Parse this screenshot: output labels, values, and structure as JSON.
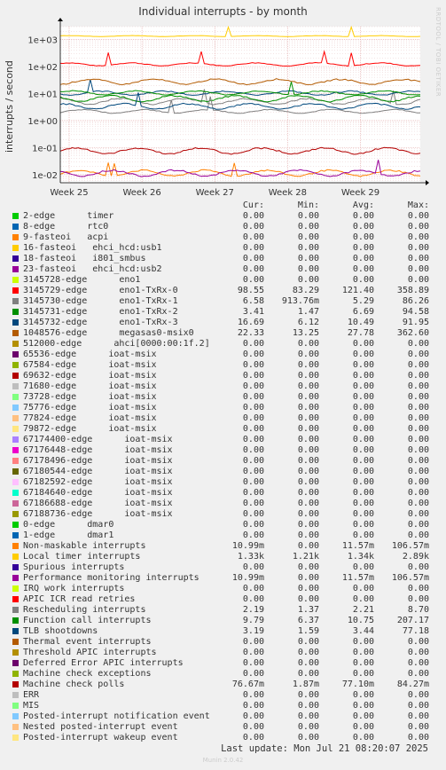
{
  "title": "Individual interrupts - by month",
  "side_text": "RRDTOOL / TOBI OETIKER",
  "columns": [
    "Cur:",
    "Min:",
    "Avg:",
    "Max:"
  ],
  "footer": "Last update: Mon Jul 21 08:20:07 2025",
  "munin_version": "Munin 2.0.42",
  "chart_data": {
    "type": "line",
    "title": "Individual interrupts - by month",
    "ylabel": "interrupts / second",
    "yscale": "log",
    "ylim": [
      0.005,
      3000
    ],
    "yticks": [
      "1e-02",
      "1e-01",
      "1e+00",
      "1e+01",
      "1e+02",
      "1e+03"
    ],
    "x_ticks": [
      "Week 25",
      "Week 26",
      "Week 27",
      "Week 28",
      "Week 29"
    ],
    "grid": true,
    "series": [
      {
        "name": "2-edge      timer",
        "color": "#00cc00",
        "cur": "0.00",
        "min": "0.00",
        "avg": "0.00",
        "max": "0.00"
      },
      {
        "name": "8-edge      rtc0",
        "color": "#0066b3",
        "cur": "0.00",
        "min": "0.00",
        "avg": "0.00",
        "max": "0.00"
      },
      {
        "name": "9-fasteoi   acpi",
        "color": "#ff8000",
        "cur": "0.00",
        "min": "0.00",
        "avg": "0.00",
        "max": "0.00"
      },
      {
        "name": "16-fasteoi   ehci_hcd:usb1",
        "color": "#ffcc00",
        "cur": "0.00",
        "min": "0.00",
        "avg": "0.00",
        "max": "0.00"
      },
      {
        "name": "18-fasteoi   i801_smbus",
        "color": "#330099",
        "cur": "0.00",
        "min": "0.00",
        "avg": "0.00",
        "max": "0.00"
      },
      {
        "name": "23-fasteoi   ehci_hcd:usb2",
        "color": "#990099",
        "cur": "0.00",
        "min": "0.00",
        "avg": "0.00",
        "max": "0.00"
      },
      {
        "name": "3145728-edge      eno1",
        "color": "#ccff00",
        "cur": "0.00",
        "min": "0.00",
        "avg": "0.00",
        "max": "0.00"
      },
      {
        "name": "3145729-edge      eno1-TxRx-0",
        "color": "#ff0000",
        "cur": "98.55",
        "min": "83.29",
        "avg": "121.40",
        "max": "358.89"
      },
      {
        "name": "3145730-edge      eno1-TxRx-1",
        "color": "#808080",
        "cur": "6.58",
        "min": "913.76m",
        "avg": "5.29",
        "max": "86.26"
      },
      {
        "name": "3145731-edge      eno1-TxRx-2",
        "color": "#008f00",
        "cur": "3.41",
        "min": "1.47",
        "avg": "6.69",
        "max": "94.58"
      },
      {
        "name": "3145732-edge      eno1-TxRx-3",
        "color": "#00487d",
        "cur": "16.69",
        "min": "6.12",
        "avg": "10.49",
        "max": "91.95"
      },
      {
        "name": "1048576-edge      megasas0-msix0",
        "color": "#b35a00",
        "cur": "22.33",
        "min": "13.25",
        "avg": "27.78",
        "max": "362.60"
      },
      {
        "name": "512000-edge      ahci[0000:00:1f.2]",
        "color": "#b38f00",
        "cur": "0.00",
        "min": "0.00",
        "avg": "0.00",
        "max": "0.00"
      },
      {
        "name": "65536-edge      ioat-msix",
        "color": "#6b006b",
        "cur": "0.00",
        "min": "0.00",
        "avg": "0.00",
        "max": "0.00"
      },
      {
        "name": "67584-edge      ioat-msix",
        "color": "#8fb300",
        "cur": "0.00",
        "min": "0.00",
        "avg": "0.00",
        "max": "0.00"
      },
      {
        "name": "69632-edge      ioat-msix",
        "color": "#b30000",
        "cur": "0.00",
        "min": "0.00",
        "avg": "0.00",
        "max": "0.00"
      },
      {
        "name": "71680-edge      ioat-msix",
        "color": "#bebebe",
        "cur": "0.00",
        "min": "0.00",
        "avg": "0.00",
        "max": "0.00"
      },
      {
        "name": "73728-edge      ioat-msix",
        "color": "#80ff80",
        "cur": "0.00",
        "min": "0.00",
        "avg": "0.00",
        "max": "0.00"
      },
      {
        "name": "75776-edge      ioat-msix",
        "color": "#80c9ff",
        "cur": "0.00",
        "min": "0.00",
        "avg": "0.00",
        "max": "0.00"
      },
      {
        "name": "77824-edge      ioat-msix",
        "color": "#ffc080",
        "cur": "0.00",
        "min": "0.00",
        "avg": "0.00",
        "max": "0.00"
      },
      {
        "name": "79872-edge      ioat-msix",
        "color": "#ffe680",
        "cur": "0.00",
        "min": "0.00",
        "avg": "0.00",
        "max": "0.00"
      },
      {
        "name": "67174400-edge      ioat-msix",
        "color": "#aa80ff",
        "cur": "0.00",
        "min": "0.00",
        "avg": "0.00",
        "max": "0.00"
      },
      {
        "name": "67176448-edge      ioat-msix",
        "color": "#ee00cc",
        "cur": "0.00",
        "min": "0.00",
        "avg": "0.00",
        "max": "0.00"
      },
      {
        "name": "67178496-edge      ioat-msix",
        "color": "#ff8080",
        "cur": "0.00",
        "min": "0.00",
        "avg": "0.00",
        "max": "0.00"
      },
      {
        "name": "67180544-edge      ioat-msix",
        "color": "#666600",
        "cur": "0.00",
        "min": "0.00",
        "avg": "0.00",
        "max": "0.00"
      },
      {
        "name": "67182592-edge      ioat-msix",
        "color": "#ffbfff",
        "cur": "0.00",
        "min": "0.00",
        "avg": "0.00",
        "max": "0.00"
      },
      {
        "name": "67184640-edge      ioat-msix",
        "color": "#00ffcc",
        "cur": "0.00",
        "min": "0.00",
        "avg": "0.00",
        "max": "0.00"
      },
      {
        "name": "67186688-edge      ioat-msix",
        "color": "#cc6699",
        "cur": "0.00",
        "min": "0.00",
        "avg": "0.00",
        "max": "0.00"
      },
      {
        "name": "67188736-edge      ioat-msix",
        "color": "#999900",
        "cur": "0.00",
        "min": "0.00",
        "avg": "0.00",
        "max": "0.00"
      },
      {
        "name": "0-edge      dmar0",
        "color": "#00cc00",
        "cur": "0.00",
        "min": "0.00",
        "avg": "0.00",
        "max": "0.00"
      },
      {
        "name": "1-edge      dmar1",
        "color": "#0066b3",
        "cur": "0.00",
        "min": "0.00",
        "avg": "0.00",
        "max": "0.00"
      },
      {
        "name": "Non-maskable interrupts",
        "color": "#ff8000",
        "cur": "10.99m",
        "min": "0.00",
        "avg": "11.57m",
        "max": "106.57m"
      },
      {
        "name": "Local timer interrupts",
        "color": "#ffcc00",
        "cur": "1.33k",
        "min": "1.21k",
        "avg": "1.34k",
        "max": "2.89k"
      },
      {
        "name": "Spurious interrupts",
        "color": "#330099",
        "cur": "0.00",
        "min": "0.00",
        "avg": "0.00",
        "max": "0.00"
      },
      {
        "name": "Performance monitoring interrupts",
        "color": "#990099",
        "cur": "10.99m",
        "min": "0.00",
        "avg": "11.57m",
        "max": "106.57m"
      },
      {
        "name": "IRQ work interrupts",
        "color": "#ccff00",
        "cur": "0.00",
        "min": "0.00",
        "avg": "0.00",
        "max": "0.00"
      },
      {
        "name": "APIC ICR read retries",
        "color": "#ff0000",
        "cur": "0.00",
        "min": "0.00",
        "avg": "0.00",
        "max": "0.00"
      },
      {
        "name": "Rescheduling interrupts",
        "color": "#808080",
        "cur": "2.19",
        "min": "1.37",
        "avg": "2.21",
        "max": "8.70"
      },
      {
        "name": "Function call interrupts",
        "color": "#008f00",
        "cur": "9.79",
        "min": "6.37",
        "avg": "10.75",
        "max": "207.17"
      },
      {
        "name": "TLB shootdowns",
        "color": "#00487d",
        "cur": "3.19",
        "min": "1.59",
        "avg": "3.44",
        "max": "77.18"
      },
      {
        "name": "Thermal event interrupts",
        "color": "#b35a00",
        "cur": "0.00",
        "min": "0.00",
        "avg": "0.00",
        "max": "0.00"
      },
      {
        "name": "Threshold APIC interrupts",
        "color": "#b38f00",
        "cur": "0.00",
        "min": "0.00",
        "avg": "0.00",
        "max": "0.00"
      },
      {
        "name": "Deferred Error APIC interrupts",
        "color": "#6b006b",
        "cur": "0.00",
        "min": "0.00",
        "avg": "0.00",
        "max": "0.00"
      },
      {
        "name": "Machine check exceptions",
        "color": "#8fb300",
        "cur": "0.00",
        "min": "0.00",
        "avg": "0.00",
        "max": "0.00"
      },
      {
        "name": "Machine check polls",
        "color": "#b30000",
        "cur": "76.67m",
        "min": "1.87m",
        "avg": "77.10m",
        "max": "84.27m"
      },
      {
        "name": "ERR",
        "color": "#bebebe",
        "cur": "0.00",
        "min": "0.00",
        "avg": "0.00",
        "max": "0.00"
      },
      {
        "name": "MIS",
        "color": "#80ff80",
        "cur": "0.00",
        "min": "0.00",
        "avg": "0.00",
        "max": "0.00"
      },
      {
        "name": "Posted-interrupt notification event",
        "color": "#80c9ff",
        "cur": "0.00",
        "min": "0.00",
        "avg": "0.00",
        "max": "0.00"
      },
      {
        "name": "Nested posted-interrupt event",
        "color": "#ffc080",
        "cur": "0.00",
        "min": "0.00",
        "avg": "0.00",
        "max": "0.00"
      },
      {
        "name": "Posted-interrupt wakeup event",
        "color": "#ffe680",
        "cur": "0.00",
        "min": "0.00",
        "avg": "0.00",
        "max": "0.00"
      }
    ]
  }
}
